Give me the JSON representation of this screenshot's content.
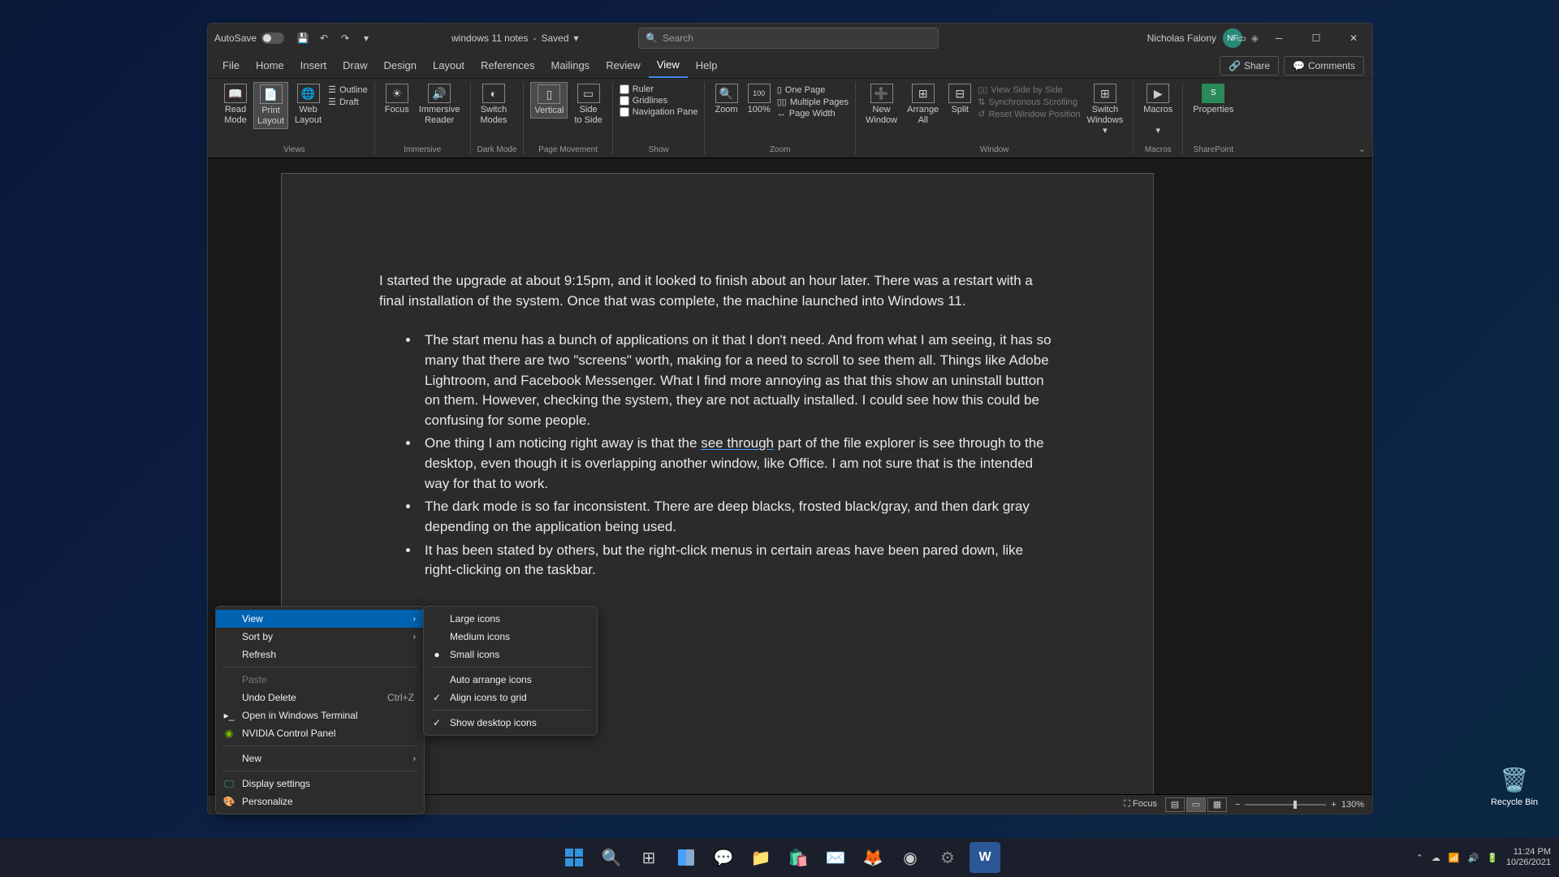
{
  "titlebar": {
    "autosave_label": "AutoSave",
    "autosave_state": "On",
    "doc_name": "windows 11 notes",
    "save_state": "Saved",
    "search_placeholder": "Search",
    "user_name": "Nicholas Falony",
    "user_initials": "NF"
  },
  "tabs": [
    "File",
    "Home",
    "Insert",
    "Draw",
    "Design",
    "Layout",
    "References",
    "Mailings",
    "Review",
    "View",
    "Help"
  ],
  "active_tab": "View",
  "share_label": "Share",
  "comments_label": "Comments",
  "ribbon": {
    "views": {
      "label": "Views",
      "read": "Read\nMode",
      "print": "Print\nLayout",
      "web": "Web\nLayout",
      "outline": "Outline",
      "draft": "Draft"
    },
    "immersive": {
      "label": "Immersive",
      "focus": "Focus",
      "reader": "Immersive\nReader"
    },
    "darkmode": {
      "label": "Dark Mode",
      "switch": "Switch\nModes"
    },
    "pagemovement": {
      "label": "Page Movement",
      "vertical": "Vertical",
      "side": "Side\nto Side"
    },
    "show": {
      "label": "Show",
      "ruler": "Ruler",
      "gridlines": "Gridlines",
      "nav": "Navigation Pane"
    },
    "zoom": {
      "label": "Zoom",
      "zoom": "Zoom",
      "hundred": "100%",
      "one_page": "One Page",
      "multiple": "Multiple Pages",
      "page_width": "Page Width"
    },
    "window": {
      "label": "Window",
      "new": "New\nWindow",
      "arrange": "Arrange\nAll",
      "split": "Split",
      "side_by_side": "View Side by Side",
      "sync_scroll": "Synchronous Scrolling",
      "reset": "Reset Window Position",
      "switch": "Switch\nWindows"
    },
    "macros": {
      "label": "Macros",
      "macros": "Macros"
    },
    "sharepoint": {
      "label": "SharePoint",
      "properties": "Properties"
    }
  },
  "document": {
    "intro": "I started the upgrade at about 9:15pm, and it looked to finish about an hour later. There was a restart with a final installation of the system. Once that was complete, the machine launched into Windows 11.",
    "bullet1": "The start menu has a bunch of applications on it that I don't need. And from what I am seeing, it has so many that there are two \"screens\" worth, making for a need to scroll to see them all. Things like Adobe Lightroom, and Facebook Messenger. What I find more annoying as that this show an uninstall button on them. However, checking the system, they are not actually installed. I could see how this could be confusing for some people.",
    "bullet2_a": "One thing I am noticing right away is that the ",
    "bullet2_b": "see through",
    "bullet2_c": " part of the file explorer is see through to the desktop, even though it is overlapping another window, like Office. I am not sure that is the intended way for that to work.",
    "bullet3": "The dark mode is so far inconsistent. There are deep blacks, frosted black/gray, and then dark gray depending on the application being used.",
    "bullet4": "It has been stated by others, but the right-click menus in certain areas have been pared down, like right-clicking on the taskbar."
  },
  "status": {
    "focus": "Focus",
    "zoom": "130%"
  },
  "context_menu": {
    "items": [
      {
        "label": "View",
        "arrow": true,
        "highlighted": true
      },
      {
        "label": "Sort by",
        "arrow": true
      },
      {
        "label": "Refresh"
      },
      {
        "sep": true
      },
      {
        "label": "Paste",
        "disabled": true
      },
      {
        "label": "Undo Delete",
        "shortcut": "Ctrl+Z"
      },
      {
        "label": "Open in Windows Terminal",
        "icon": "terminal"
      },
      {
        "label": "NVIDIA Control Panel",
        "icon": "nvidia"
      },
      {
        "sep": true
      },
      {
        "label": "New",
        "arrow": true
      },
      {
        "sep": true
      },
      {
        "label": "Display settings",
        "icon": "display"
      },
      {
        "label": "Personalize",
        "icon": "personalize"
      }
    ],
    "submenu": [
      {
        "label": "Large icons"
      },
      {
        "label": "Medium icons"
      },
      {
        "label": "Small icons",
        "radio": true
      },
      {
        "sep": true
      },
      {
        "label": "Auto arrange icons"
      },
      {
        "label": "Align icons to grid",
        "check": true
      },
      {
        "sep": true
      },
      {
        "label": "Show desktop icons",
        "check": true
      }
    ]
  },
  "recycle_bin": "Recycle Bin",
  "taskbar_icons": [
    "start",
    "search",
    "taskview",
    "widgets",
    "chat",
    "explorer",
    "store",
    "mail",
    "firefox",
    "steam",
    "obs",
    "word"
  ],
  "systray": {
    "time": "11:24 PM",
    "date": "10/26/2021"
  }
}
